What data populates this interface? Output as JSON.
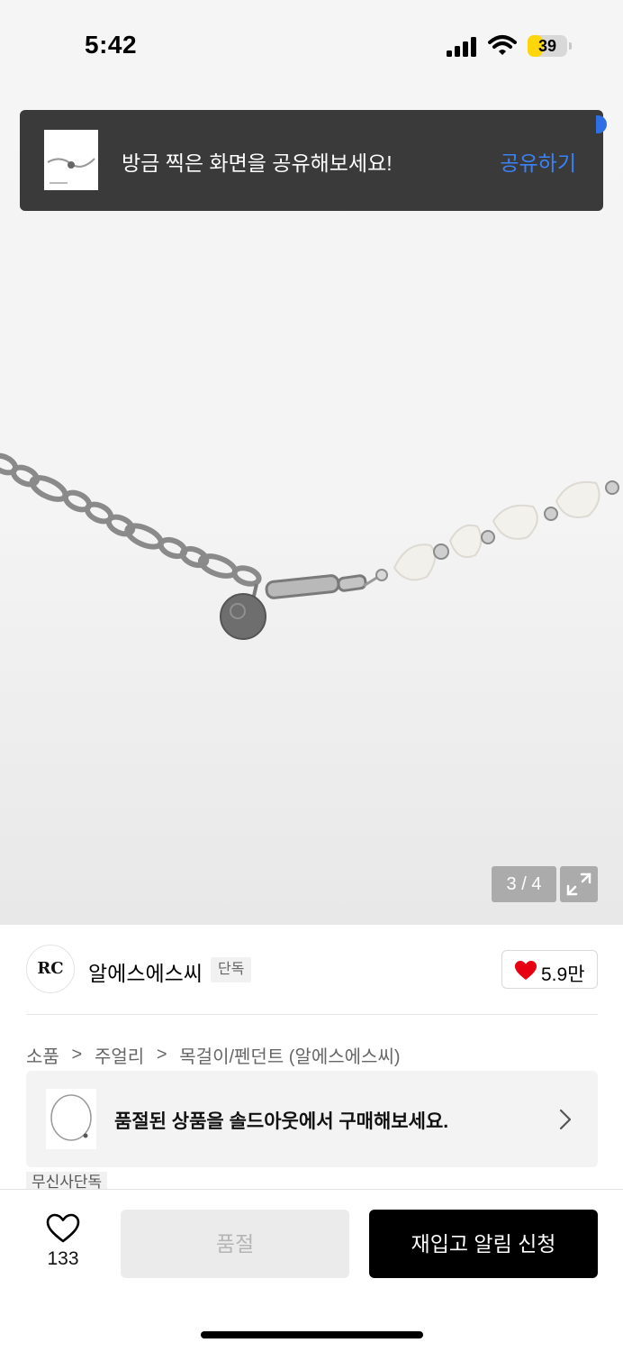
{
  "status_bar": {
    "time": "5:42",
    "battery_level": "39",
    "battery_color": "#ffd60a"
  },
  "share_toast": {
    "message": "방금 찍은 화면을 공유해보세요!",
    "action_label": "공유하기",
    "action_color": "#3b82f6"
  },
  "gallery": {
    "counter": "3 / 4",
    "current_index": 3,
    "total": 4,
    "expand_icon": "expand-icon"
  },
  "brand": {
    "logo_text": "RC",
    "name": "알에스에스씨",
    "badge": "단독"
  },
  "likes": {
    "count": "5.9만",
    "heart_color": "#e60012"
  },
  "breadcrumb": {
    "items": [
      "소품",
      "주얼리",
      "목걸이/펜던트 (알에스에스씨)"
    ],
    "separator": ">"
  },
  "soldout_banner": {
    "text": "품절된 상품을 솔드아웃에서 구매해보세요."
  },
  "tag": {
    "label": "무신사단독"
  },
  "bottom_bar": {
    "wish_count": "133",
    "soldout_label": "품절",
    "restock_label": "재입고 알림 신청"
  }
}
